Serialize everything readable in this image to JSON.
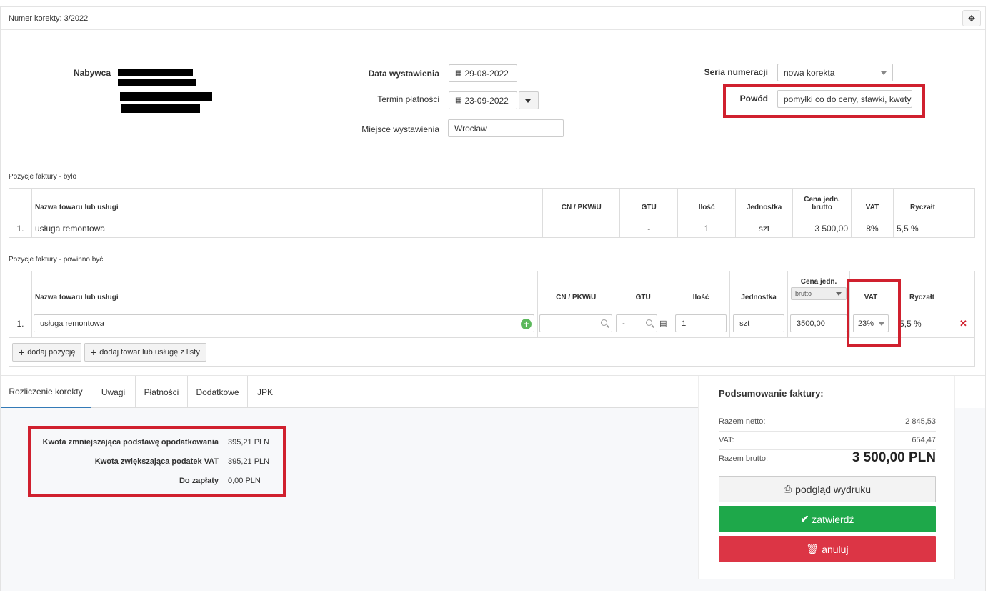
{
  "header": {
    "title": "Numer korekty: 3/2022",
    "move_icon": "move-icon"
  },
  "buyer": {
    "label": "Nabywca"
  },
  "dates": {
    "issue_label": "Data wystawienia",
    "issue_value": "29-08-2022",
    "due_label": "Termin płatności",
    "due_value": "23-09-2022",
    "place_label": "Miejsce wystawienia",
    "place_value": "Wrocław"
  },
  "series": {
    "label": "Seria numeracji",
    "value": "nowa korekta"
  },
  "reason": {
    "label": "Powód",
    "value": "pomyłki co do ceny, stawki, kwoty"
  },
  "was": {
    "title": "Pozycje faktury - było",
    "columns": [
      "",
      "Nazwa towaru lub usługi",
      "CN / PKWiU",
      "GTU",
      "Ilość",
      "Jednostka",
      "Cena jedn. brutto",
      "VAT",
      "Ryczałt",
      ""
    ],
    "rows": [
      {
        "no": "1.",
        "name": "usługa remontowa",
        "cn": "",
        "gtu": "-",
        "qty": "1",
        "unit": "szt",
        "price": "3 500,00",
        "vat": "8%",
        "flat": "5,5 %"
      }
    ]
  },
  "should": {
    "title": "Pozycje faktury - powinno być",
    "columns": {
      "name": "Nazwa towaru lub usługi",
      "cn": "CN / PKWiU",
      "gtu": "GTU",
      "qty": "Ilość",
      "unit": "Jednostka",
      "price": "Cena jedn.",
      "price_type": "brutto",
      "vat": "VAT",
      "flat": "Ryczałt"
    },
    "row": {
      "no": "1.",
      "name": "usługa remontowa",
      "cn": "",
      "gtu": "-",
      "qty": "1",
      "unit": "szt",
      "price": "3500,00",
      "vat": "23%",
      "flat": "5,5 %"
    },
    "add_position": "dodaj pozycję",
    "add_from_list": "dodaj towar lub usługę z listy"
  },
  "tabs": [
    "Rozliczenie korekty",
    "Uwagi",
    "Płatności",
    "Dodatkowe",
    "JPK"
  ],
  "settlement": {
    "rows": [
      {
        "label": "Kwota zmniejszająca podstawę opodatkowania",
        "value": "395,21 PLN"
      },
      {
        "label": "Kwota zwiększająca podatek VAT",
        "value": "395,21 PLN"
      },
      {
        "label": "Do zapłaty",
        "value": "0,00 PLN"
      }
    ]
  },
  "summary": {
    "title": "Podsumowanie faktury:",
    "net_label": "Razem netto:",
    "net_value": "2 845,53",
    "vat_label": "VAT:",
    "vat_value": "654,47",
    "gross_label": "Razem brutto:",
    "gross_value": "3 500,00 PLN",
    "print_label": "podgląd wydruku",
    "confirm_label": "zatwierdź",
    "cancel_label": "anuluj"
  },
  "colors": {
    "highlight": "#d0202e",
    "confirm": "#1ea84a",
    "cancel": "#dc3545",
    "tab_active": "#337ab7"
  }
}
